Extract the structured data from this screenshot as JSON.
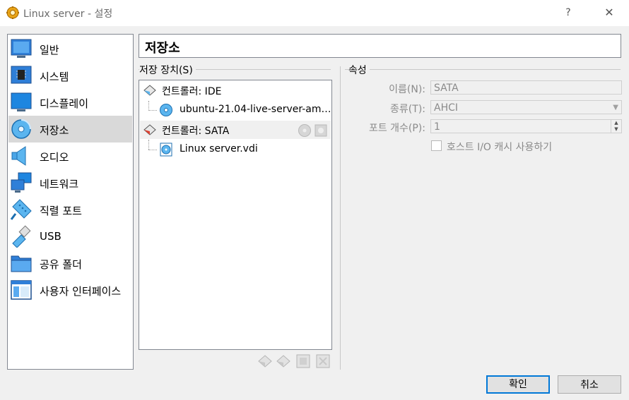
{
  "window": {
    "title": "Linux server - 설정",
    "help": "?",
    "close": "✕"
  },
  "sidebar": {
    "items": [
      {
        "label": "일반",
        "icon": "general-icon"
      },
      {
        "label": "시스템",
        "icon": "chip-icon"
      },
      {
        "label": "디스플레이",
        "icon": "monitor-icon"
      },
      {
        "label": "저장소",
        "icon": "storage-disk-icon",
        "selected": true
      },
      {
        "label": "오디오",
        "icon": "speaker-icon"
      },
      {
        "label": "네트워크",
        "icon": "network-icon"
      },
      {
        "label": "직렬 포트",
        "icon": "serial-port-icon"
      },
      {
        "label": "USB",
        "icon": "usb-icon"
      },
      {
        "label": "공유 폴더",
        "icon": "folder-icon"
      },
      {
        "label": "사용자 인터페이스",
        "icon": "ui-window-icon"
      }
    ]
  },
  "page": {
    "title": "저장소"
  },
  "storage": {
    "header": "저장 장치(S)",
    "tree": [
      {
        "label": "컨트롤러: IDE",
        "type": "controller"
      },
      {
        "label": "ubuntu-21.04-live-server-am…",
        "type": "optical"
      },
      {
        "label": "컨트롤러: SATA",
        "type": "controller",
        "selected": true
      },
      {
        "label": "Linux server.vdi",
        "type": "hdd"
      }
    ]
  },
  "attributes": {
    "header": "속성",
    "name_label": "이름(N):",
    "name_value": "SATA",
    "type_label": "종류(T):",
    "type_value": "AHCI",
    "ports_label": "포트 개수(P):",
    "ports_value": "1",
    "cache_label": "호스트 I/O 캐시 사용하기",
    "cache_checked": false
  },
  "buttons": {
    "ok": "확인",
    "cancel": "취소"
  },
  "colors": {
    "accent": "#0078d7",
    "selected_bg": "#d9d9d9"
  }
}
